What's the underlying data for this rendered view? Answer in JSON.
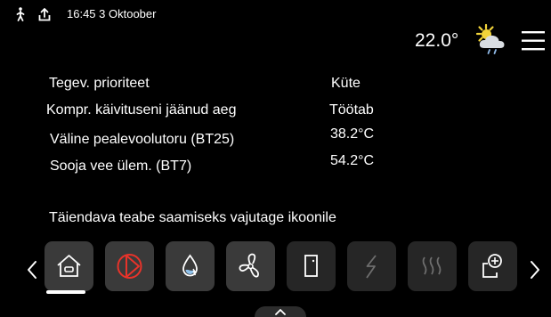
{
  "status_bar": {
    "time_date": "16:45 3 Oktoober",
    "icons": [
      "person-walking-icon",
      "upload-icon"
    ]
  },
  "header": {
    "temperature": "22.0°",
    "weather_icon": "sun-behind-cloud-icon",
    "menu_icon": "hamburger-menu-icon"
  },
  "info_rows": [
    {
      "label": "Tegev. prioriteet",
      "value": "Küte"
    },
    {
      "label": "Kompr. käivituseni jäänud aeg",
      "value": "Töötab"
    },
    {
      "label": "Väline pealevoolutoru (BT25)",
      "value": "38.2°C"
    },
    {
      "label": "Sooja vee ülem. (BT7)",
      "value": "54.2°C"
    }
  ],
  "hint": "Täiendava teabe saamiseks vajutage ikoonile",
  "tiles": [
    {
      "icon": "home-icon",
      "state": "selected"
    },
    {
      "icon": "heating-pump-icon",
      "state": "active",
      "color": "#e8332a"
    },
    {
      "icon": "water-drop-icon",
      "state": "active"
    },
    {
      "icon": "fan-icon",
      "state": "active"
    },
    {
      "icon": "door-icon",
      "state": "active"
    },
    {
      "icon": "electric-icon",
      "state": "inactive"
    },
    {
      "icon": "floor-heating-icon",
      "state": "inactive"
    },
    {
      "icon": "add-accessory-icon",
      "state": "active"
    }
  ],
  "nav": {
    "left_icon": "chevron-left-icon",
    "right_icon": "chevron-right-icon"
  },
  "accent_color": "#e8332a"
}
